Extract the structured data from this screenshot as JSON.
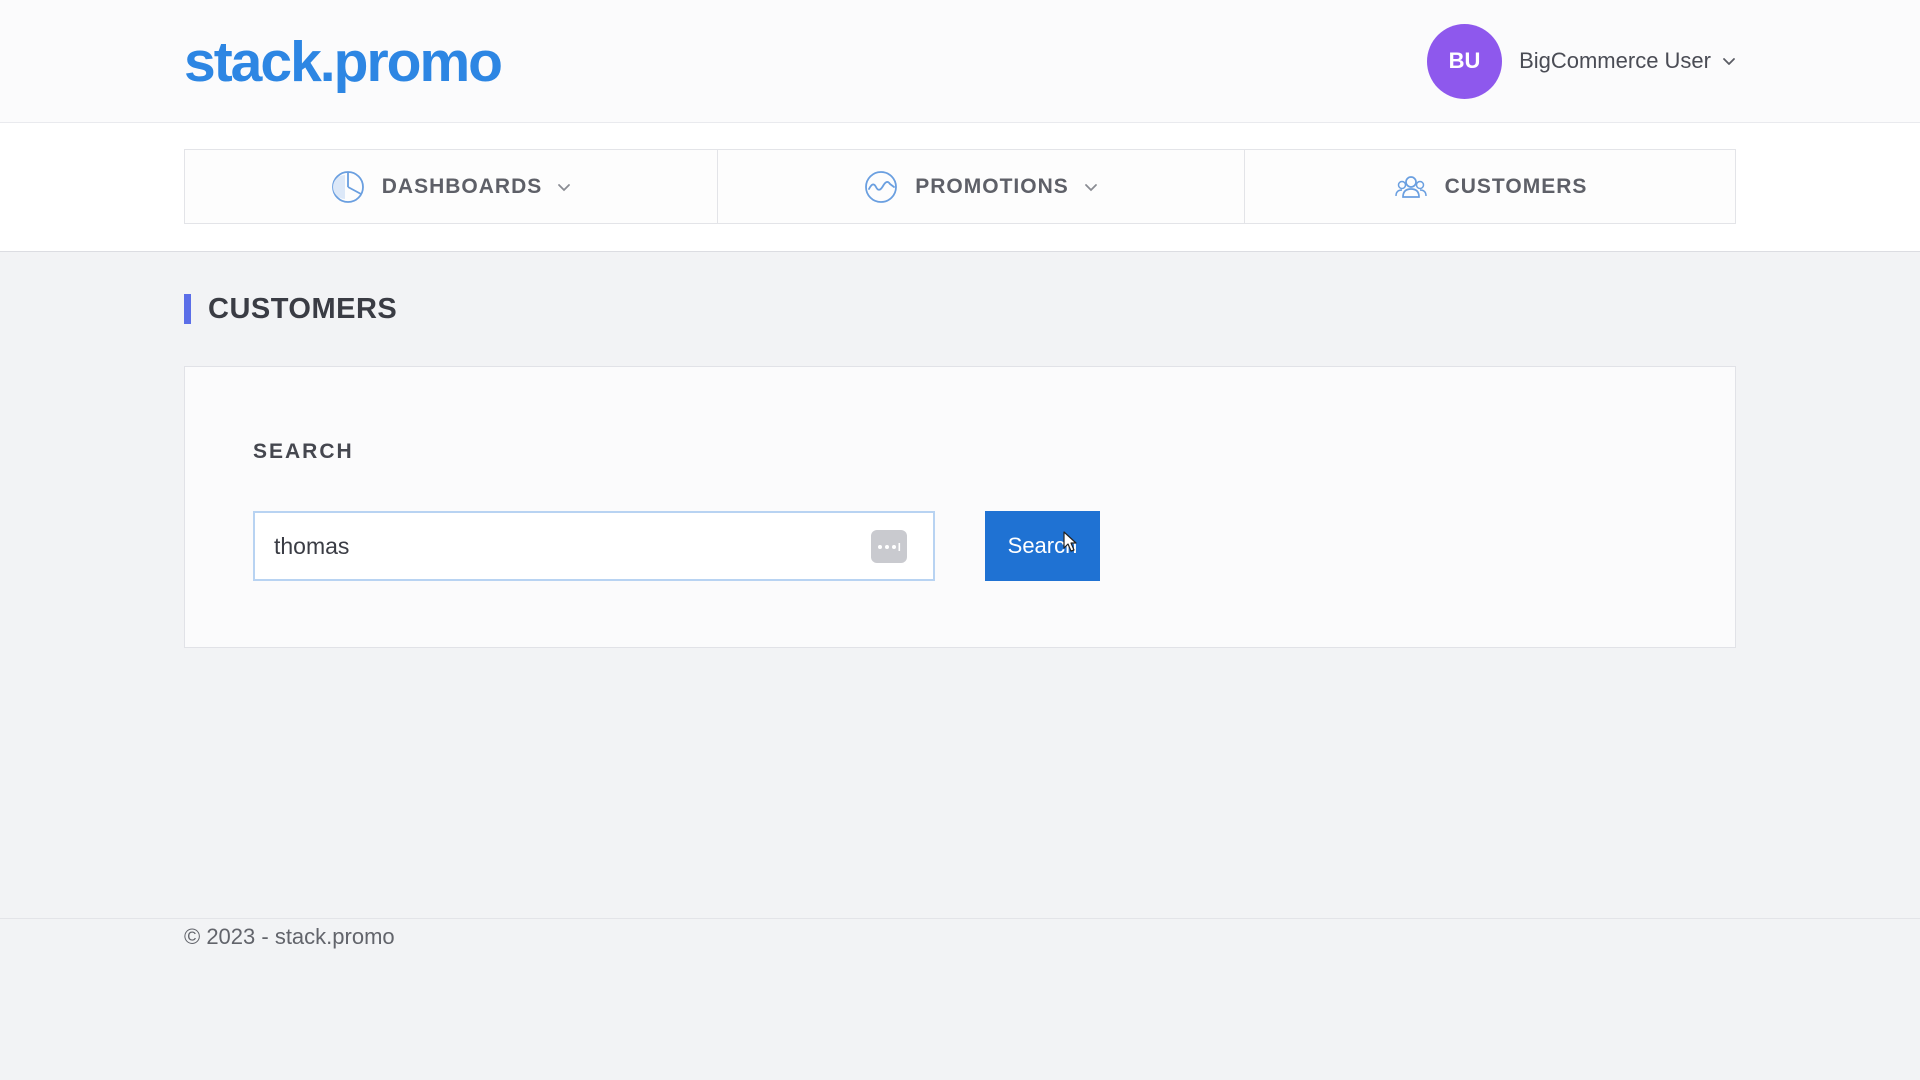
{
  "brand": {
    "logo_text": "stack.promo",
    "accent_color": "#2d86e3"
  },
  "user": {
    "initials": "BU",
    "name": "BigCommerce User",
    "avatar_color": "#8e58ed",
    "menu_icon": "chevron-down-icon"
  },
  "nav": {
    "items": [
      {
        "label": "DASHBOARDS",
        "icon": "pie-chart-icon",
        "has_dropdown": true
      },
      {
        "label": "PROMOTIONS",
        "icon": "wave-chart-icon",
        "has_dropdown": true
      },
      {
        "label": "CUSTOMERS",
        "icon": "users-icon",
        "has_dropdown": false
      }
    ]
  },
  "page": {
    "title": "CUSTOMERS",
    "title_accent": "#5b6ee8"
  },
  "search": {
    "label": "SEARCH",
    "query": "thomas",
    "field_extension_icon": "more-dots-icon",
    "button_label": "Search",
    "button_color": "#1f72d3"
  },
  "footer": {
    "text": "© 2023 - stack.promo"
  }
}
